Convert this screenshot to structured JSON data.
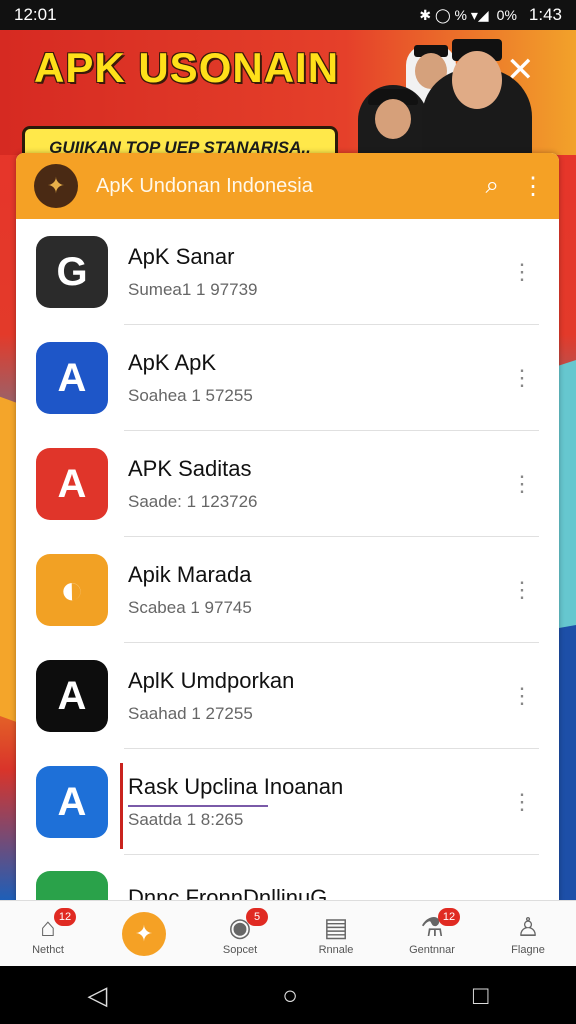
{
  "status_bar": {
    "time": "12:01",
    "right_icons": "✱  ◯  %  ▾◢",
    "battery": "0%",
    "right_time": "1:43"
  },
  "banner": {
    "title": "APK USONAIN",
    "subtitle": "GUIIKAN TOP UEP STANARISA.."
  },
  "header": {
    "title": "ApK Undonan Indonesia"
  },
  "apps": [
    {
      "name": "ApK Sanar",
      "sub": "Sumea1 1 97739",
      "icon_glyph": "G",
      "icon_bg": "#2b2b2b"
    },
    {
      "name": "ApK ApK",
      "sub": "Soahea 1 57255",
      "icon_glyph": "A",
      "icon_bg": "#1e56c8"
    },
    {
      "name": "APK Saditas",
      "sub": "Saade: 1 123726",
      "icon_glyph": "A",
      "icon_bg": "#e0352a"
    },
    {
      "name": "Apik Marada",
      "sub": "Scabea 1 97745",
      "icon_glyph": "◐",
      "icon_bg": "#f2a124"
    },
    {
      "name": "AplK Umdporkan",
      "sub": "Saahad 1 27255",
      "icon_glyph": "A",
      "icon_bg": "#0d0d0d"
    },
    {
      "name": "Rask Upclina Inoanan",
      "sub": "Saatda 1 8:265",
      "icon_glyph": "A",
      "icon_bg": "#1e70d8"
    },
    {
      "name": "Dnnc FronnDnllinuG",
      "sub": "",
      "icon_glyph": "",
      "icon_bg": "#2aa24a"
    }
  ],
  "bottom_nav": [
    {
      "label": "Nethct",
      "badge": "12",
      "glyph": "⌂"
    },
    {
      "label": "",
      "badge": "",
      "glyph": "✦"
    },
    {
      "label": "Sopcet",
      "badge": "5",
      "glyph": "◉"
    },
    {
      "label": "Rnnale",
      "badge": "",
      "glyph": "▤"
    },
    {
      "label": "Gentnnar",
      "badge": "12",
      "glyph": "⚗"
    },
    {
      "label": "Flagne",
      "badge": "",
      "glyph": "♙"
    }
  ],
  "system_nav": {
    "back": "◁",
    "home": "○",
    "recents": "□"
  }
}
